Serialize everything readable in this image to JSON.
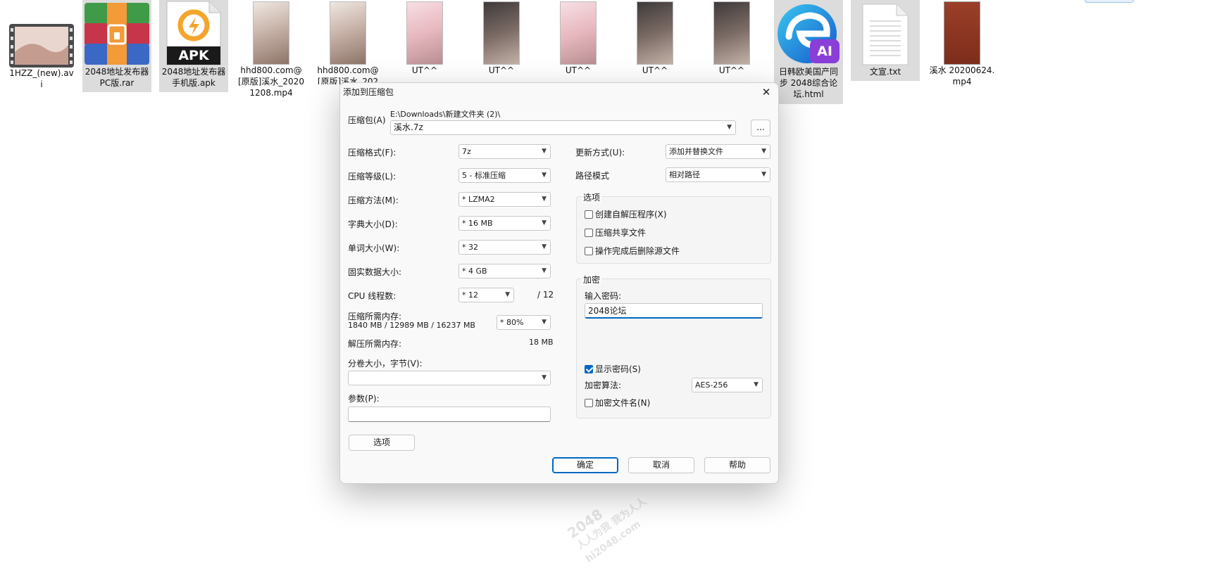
{
  "files": [
    {
      "name": "1HZZ_(new).avi",
      "icon": "video-film-icon"
    },
    {
      "name": "2048地址发布器PC版.rar",
      "icon": "rar-archive-icon"
    },
    {
      "name": "2048地址发布器手机版.apk",
      "icon": "apk-file-icon",
      "badge": "APK"
    },
    {
      "name": "hhd800.com@[原版]溪水_20201208.mp4",
      "icon": "video-thumbnail-icon"
    },
    {
      "name": "hhd800.com@[原版]溪水_202",
      "icon": "video-thumbnail-icon"
    },
    {
      "name": "UT^^",
      "icon": "video-thumbnail-icon"
    },
    {
      "name": "UT^^",
      "icon": "video-thumbnail-icon"
    },
    {
      "name": "UT^^",
      "icon": "video-thumbnail-icon"
    },
    {
      "name": "UT^^",
      "icon": "video-thumbnail-icon"
    },
    {
      "name": "UT^^",
      "icon": "video-thumbnail-icon"
    },
    {
      "name": "日韩欧美国产同步 2048综合论坛.html",
      "icon": "edge-ai-icon",
      "badge": "AI"
    },
    {
      "name": "文宣.txt",
      "icon": "text-file-icon"
    },
    {
      "name": "溪水 20200624.mp4",
      "icon": "video-thumbnail-icon"
    }
  ],
  "dialog": {
    "title": "添加到压缩包",
    "archive_label": "压缩包(A)",
    "archive_path": "E:\\Downloads\\新建文件夹 (2)\\",
    "archive_name": "溪水.7z",
    "browse_label": "...",
    "format_label": "压缩格式(F):",
    "format_value": "7z",
    "level_label": "压缩等级(L):",
    "level_value": "5 - 标准压缩",
    "method_label": "压缩方法(M):",
    "method_value": "* LZMA2",
    "dict_label": "字典大小(D):",
    "dict_value": "* 16 MB",
    "word_label": "单词大小(W):",
    "word_value": "* 32",
    "solid_label": "固实数据大小:",
    "solid_value": "* 4 GB",
    "cpu_label": "CPU 线程数:",
    "cpu_value": "* 12",
    "cpu_max": "/ 12",
    "mem_label": "压缩所需内存:",
    "mem_value": "1840 MB / 12989 MB / 16237 MB",
    "mem_percent": "* 80%",
    "decomp_label": "解压所需内存:",
    "decomp_value": "18 MB",
    "volume_label": "分卷大小，字节(V):",
    "volume_value": "",
    "params_label": "参数(P):",
    "params_value": "",
    "options_button": "选项",
    "update_label": "更新方式(U):",
    "update_value": "添加并替换文件",
    "pathmode_label": "路径模式",
    "pathmode_value": "相对路径",
    "options_group": "选项",
    "opt_sfx": "创建自解压程序(X)",
    "opt_shared": "压缩共享文件",
    "opt_delete": "操作完成后删除源文件",
    "enc_group": "加密",
    "password_label": "输入密码:",
    "password_value": "2048论坛",
    "show_password": "显示密码(S)",
    "enc_method_label": "加密算法:",
    "enc_method_value": "AES-256",
    "enc_names": "加密文件名(N)",
    "ok_button": "确定",
    "cancel_button": "取消",
    "help_button": "帮助"
  },
  "watermark": {
    "line1": "2048",
    "line2": "人人为我 我为人人",
    "line3": "hi2048.com"
  },
  "colors": {
    "accent": "#0067c0",
    "selection": "#dcdcdc",
    "dialog_bg": "#f9f9f9"
  }
}
